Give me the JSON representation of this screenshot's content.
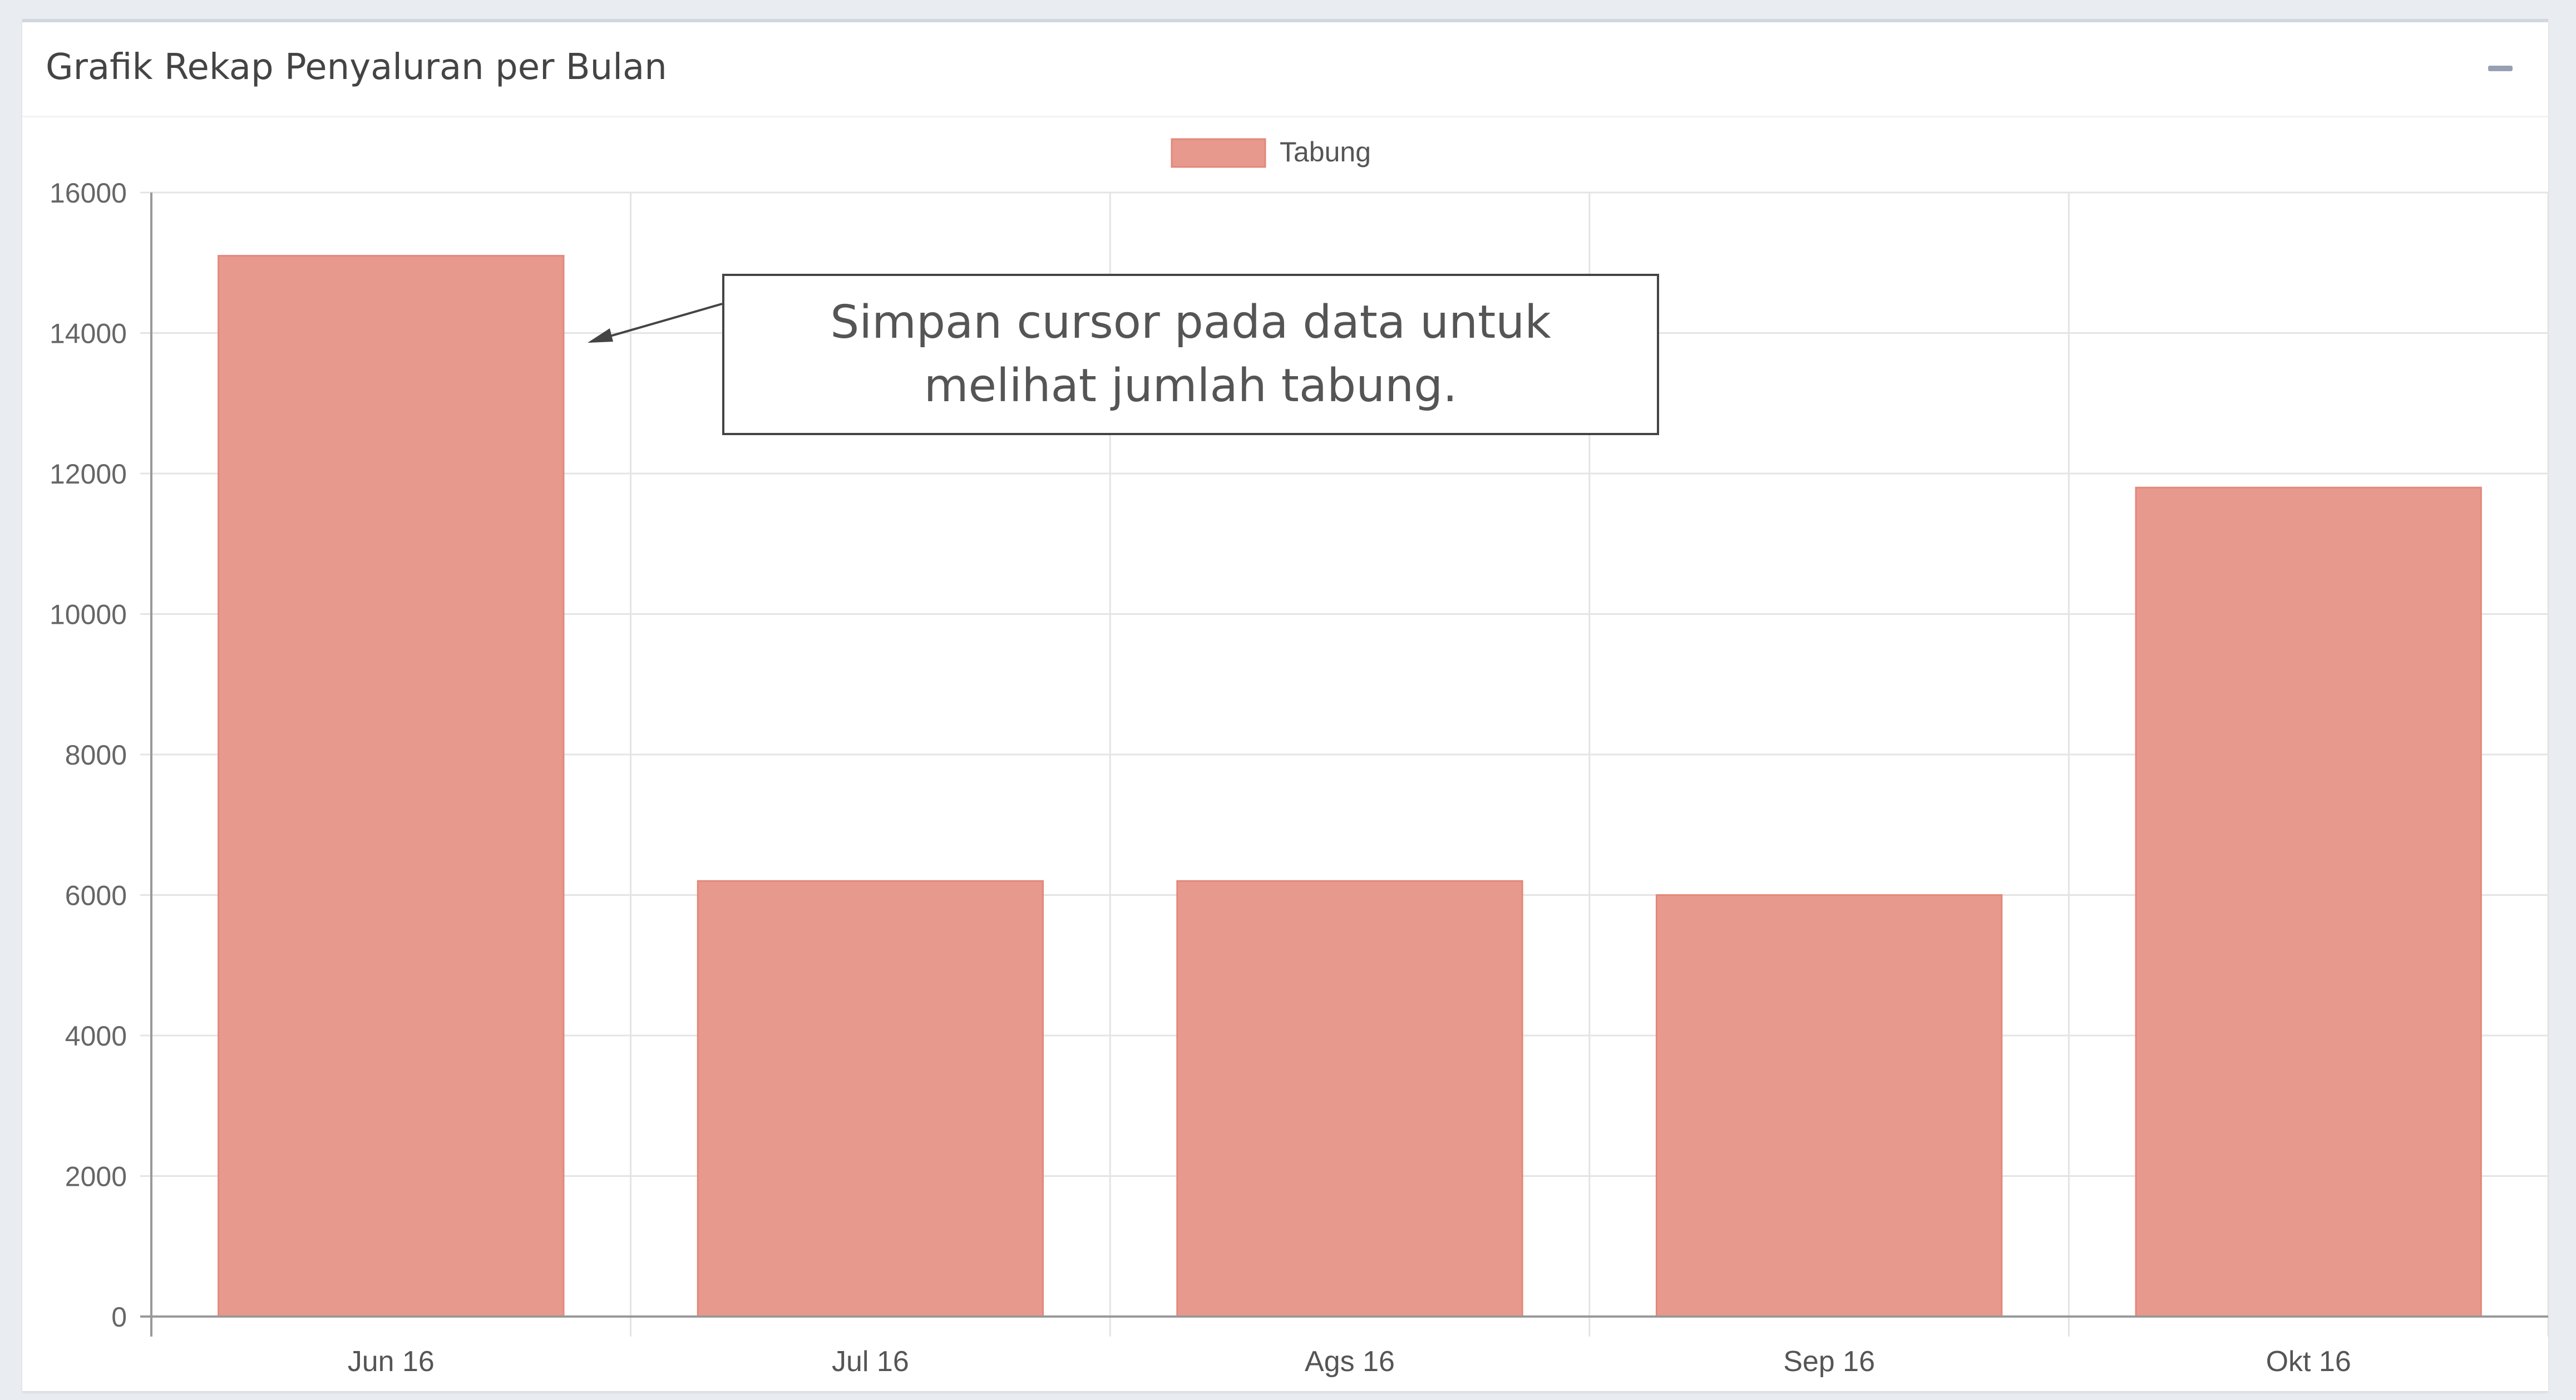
{
  "panel": {
    "title": "Grafik Rekap Penyaluran per Bulan",
    "collapse_icon": "minus-icon"
  },
  "chart_data": {
    "type": "bar",
    "categories": [
      "Jun 16",
      "Jul 16",
      "Ags 16",
      "Sep 16",
      "Okt 16"
    ],
    "series": [
      {
        "name": "Tabung",
        "values": [
          15100,
          6200,
          6200,
          6000,
          11800
        ]
      }
    ],
    "ylim": [
      0,
      16000
    ],
    "yticks": [
      0,
      2000,
      4000,
      6000,
      8000,
      10000,
      12000,
      14000,
      16000
    ],
    "legend_position": "top",
    "grid": true,
    "bar_color": "#e8998d"
  },
  "callout": {
    "text": "Simpan cursor pada data untuk melihat jumlah tabung."
  }
}
